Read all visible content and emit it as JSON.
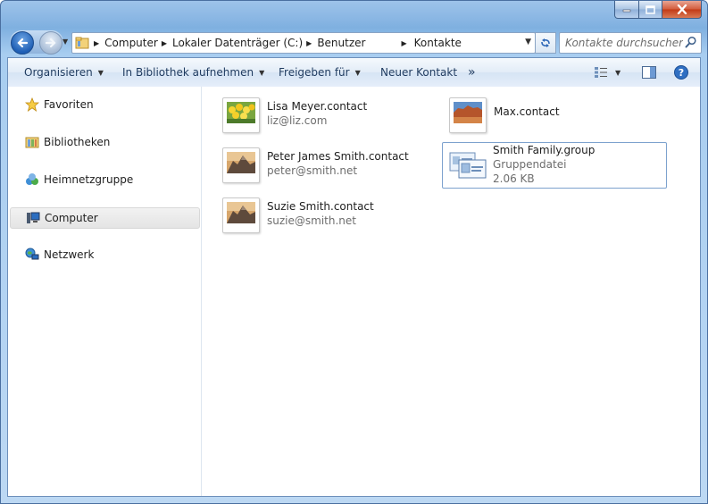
{
  "address": {
    "crumbs": [
      "Computer",
      "Lokaler Datenträger (C:)",
      "Benutzer",
      "Kontakte"
    ]
  },
  "search": {
    "placeholder": "Kontakte durchsuchen"
  },
  "toolbar": {
    "organize": "Organisieren",
    "add_library": "In Bibliothek aufnehmen",
    "share": "Freigeben für",
    "new_contact": "Neuer Kontakt",
    "more": "»"
  },
  "sidebar": {
    "items": [
      {
        "label": "Favoriten",
        "icon": "star-icon"
      },
      {
        "label": "Bibliotheken",
        "icon": "library-icon"
      },
      {
        "label": "Heimnetzgruppe",
        "icon": "homegroup-icon"
      },
      {
        "label": "Computer",
        "icon": "computer-icon",
        "selected": true
      },
      {
        "label": "Netzwerk",
        "icon": "network-icon"
      }
    ]
  },
  "files": [
    {
      "name": "Lisa Meyer.contact",
      "detail": "liz@liz.com",
      "thumb": "flowers"
    },
    {
      "name": "Max.contact",
      "detail": "",
      "thumb": "desert"
    },
    {
      "name": "Peter James Smith.contact",
      "detail": "peter@smith.net",
      "thumb": "mountain"
    },
    {
      "name": "Smith Family.group",
      "detail": "Gruppendatei",
      "detail2": "2.06 KB",
      "thumb": "group",
      "selected": true
    },
    {
      "name": "Suzie Smith.contact",
      "detail": "suzie@smith.net",
      "thumb": "mountain"
    }
  ]
}
